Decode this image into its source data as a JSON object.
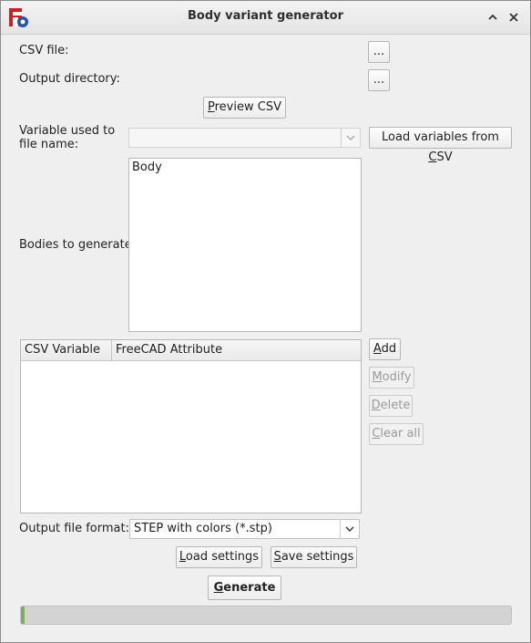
{
  "window": {
    "title": "Body variant generator",
    "icon": "freecad-icon"
  },
  "csv_file": {
    "label": "CSV file:",
    "browse_label": "..."
  },
  "output_dir": {
    "label": "Output directory:",
    "browse_label": "..."
  },
  "preview_csv": {
    "pre": "",
    "ul": "P",
    "post": "review CSV"
  },
  "file_name_var": {
    "label_line1": "Variable used to",
    "label_line2": "file name:",
    "value": ""
  },
  "load_vars": {
    "pre": "Load variables from ",
    "ul": "C",
    "post": "SV"
  },
  "bodies": {
    "label": "Bodies to generate:",
    "items": [
      "Body"
    ]
  },
  "mapping_table": {
    "columns": [
      "CSV Variable",
      "FreeCAD Attribute"
    ],
    "rows": []
  },
  "table_buttons": {
    "add": {
      "ul": "A",
      "post": "dd"
    },
    "modify": {
      "ul": "M",
      "post": "odify"
    },
    "delete": {
      "ul": "D",
      "post": "elete"
    },
    "clear_all": {
      "ul": "C",
      "post": "lear all"
    }
  },
  "output_format": {
    "label": "Output file format:",
    "value": "STEP with colors (*.stp)"
  },
  "load_settings": {
    "ul": "L",
    "post": "oad settings"
  },
  "save_settings": {
    "ul": "S",
    "post": "ave settings"
  },
  "generate": {
    "ul": "G",
    "post": "enerate"
  },
  "progress": {
    "value": 0.0
  },
  "colors": {
    "progress_fill": "#7fae5c",
    "app_icon_red": "#cc1f1f",
    "app_icon_blue": "#2255aa"
  }
}
